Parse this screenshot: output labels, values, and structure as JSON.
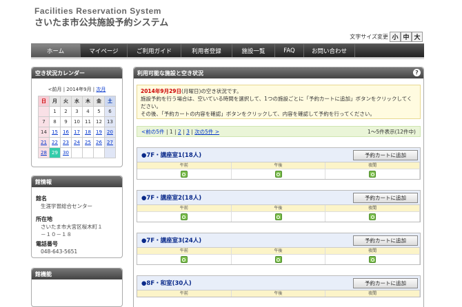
{
  "header": {
    "title_en": "Facilities Reservation System",
    "title_ja": "さいたま市公共施設予約システム",
    "font_size_label": "文字サイズ変更",
    "font_size_buttons": [
      "小",
      "中",
      "大"
    ]
  },
  "nav": {
    "items": [
      "ホーム",
      "マイページ",
      "ご利用ガイド",
      "利用者登録",
      "施設一覧",
      "FAQ",
      "お問い合わせ"
    ]
  },
  "calendar": {
    "title": "空き状況カレンダー",
    "prev": "<前月",
    "month": "2014年9月",
    "next": "次月",
    "weekdays": [
      "日",
      "月",
      "火",
      "水",
      "木",
      "金",
      "土"
    ],
    "weeks": [
      [
        "",
        "1",
        "2",
        "3",
        "4",
        "5",
        "6"
      ],
      [
        "7",
        "8",
        "9",
        "10",
        "11",
        "12",
        "13"
      ],
      [
        "14",
        "15",
        "16",
        "17",
        "18",
        "19",
        "20"
      ],
      [
        "21",
        "22",
        "23",
        "24",
        "25",
        "26",
        "27"
      ],
      [
        "28",
        "29",
        "30",
        "",
        "",
        "",
        ""
      ]
    ]
  },
  "info": {
    "title": "館情報",
    "name_label": "館名",
    "name_value": "生涯学習総合センター",
    "address_label": "所在地",
    "address_value_1": "さいたま市大宮区桜木町１",
    "address_value_2": "－１０－１８",
    "phone_label": "電話番号",
    "phone_value": "048-643-5651"
  },
  "functions": {
    "title": "館機能"
  },
  "main": {
    "title": "利用可能な施設と空き状況",
    "help": "?",
    "notice_date": "2014年9月29日",
    "notice_line1_rest": "(月曜日)の空き状況です。",
    "notice_line2": "施設予約を行う場合は、空いている時間を選択して、1つの施設ごとに「予約カートに追加」ボタンをクリックしてください。",
    "notice_line3": "その後、「予約カートの内容を確認」ボタンをクリックして、内容を確認して予約を行ってください。",
    "pager": {
      "prev": "<前の5件",
      "sep": "|",
      "pages": [
        "1",
        "2",
        "3"
      ],
      "next": "次の5件 >",
      "status": "1～5件表示(12件中)"
    },
    "slot_labels": [
      "午前",
      "午後",
      "夜間"
    ],
    "add_button": "予約カートに追加",
    "rooms": [
      {
        "name": "●7F・講座室1(18人)"
      },
      {
        "name": "●7F・講座室2(18人)"
      },
      {
        "name": "●7F・講座室3(24人)"
      },
      {
        "name": "●8F・和室(30人)"
      }
    ]
  }
}
